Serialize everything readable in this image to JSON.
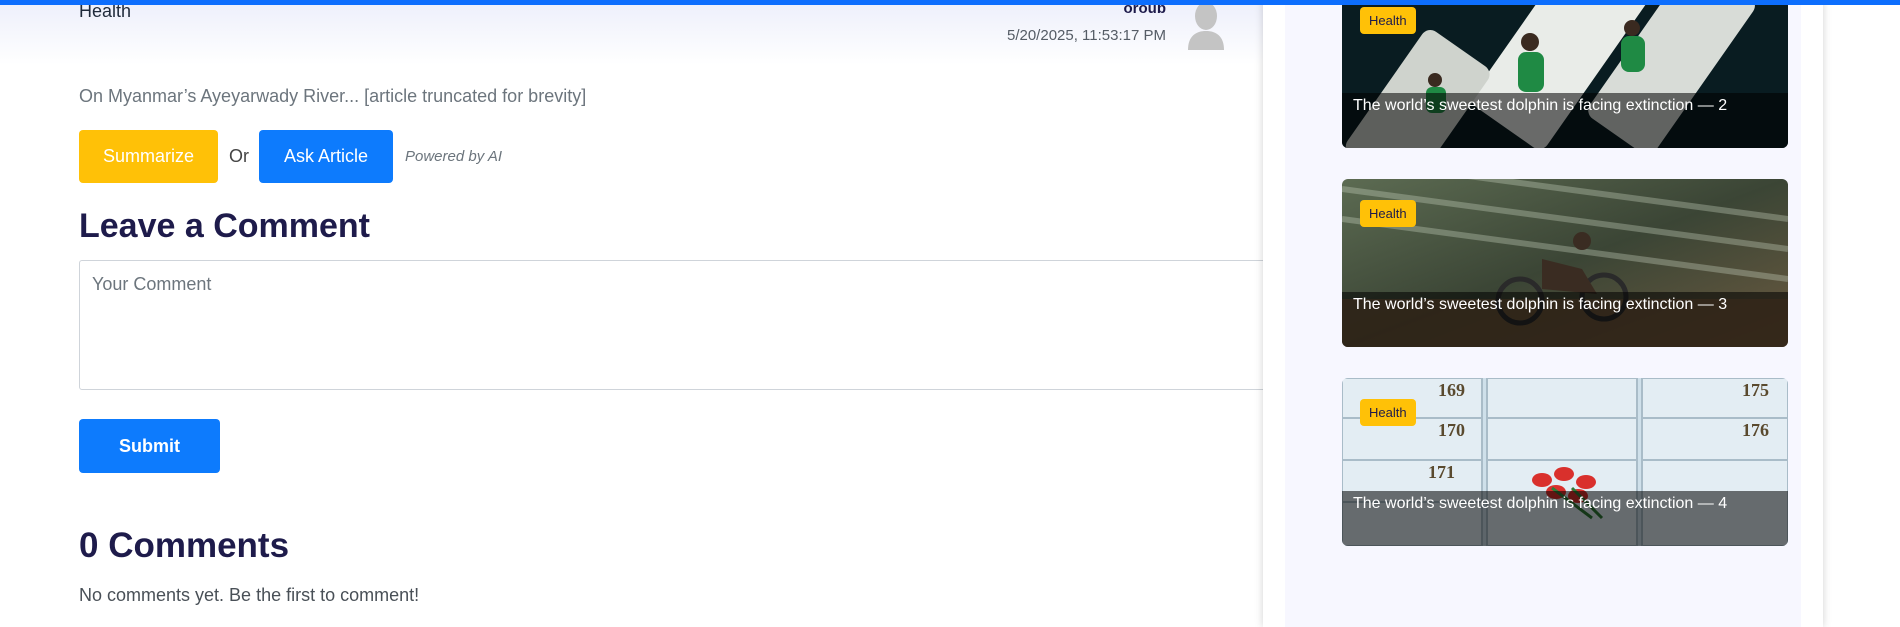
{
  "article": {
    "category": "Health",
    "author": "oroub",
    "date": "5/20/2025, 11:53:17 PM",
    "excerpt": "On Myanmar’s Ayeyarwady River... [article truncated for brevity]"
  },
  "ai_tools": {
    "summarize_label": "Summarize",
    "or_label": "Or",
    "ask_label": "Ask Article",
    "powered_label": "Powered by AI"
  },
  "comment_form": {
    "heading": "Leave a Comment",
    "placeholder": "Your Comment",
    "value": "",
    "submit_label": "Submit"
  },
  "comments": {
    "count_heading": "0 Comments",
    "empty_message": "No comments yet. Be the first to comment!"
  },
  "sidebar": {
    "cards": [
      {
        "badge": "Health",
        "title": "The world’s sweetest dolphin is facing extinction — 2"
      },
      {
        "badge": "Health",
        "title": "The world’s sweetest dolphin is facing extinction — 3"
      },
      {
        "badge": "Health",
        "title": "The world’s sweetest dolphin is facing extinction — 4"
      }
    ]
  },
  "colors": {
    "accent_blue": "#0d7bfd",
    "accent_yellow": "#ffc107",
    "heading_navy": "#1e1b4b"
  }
}
